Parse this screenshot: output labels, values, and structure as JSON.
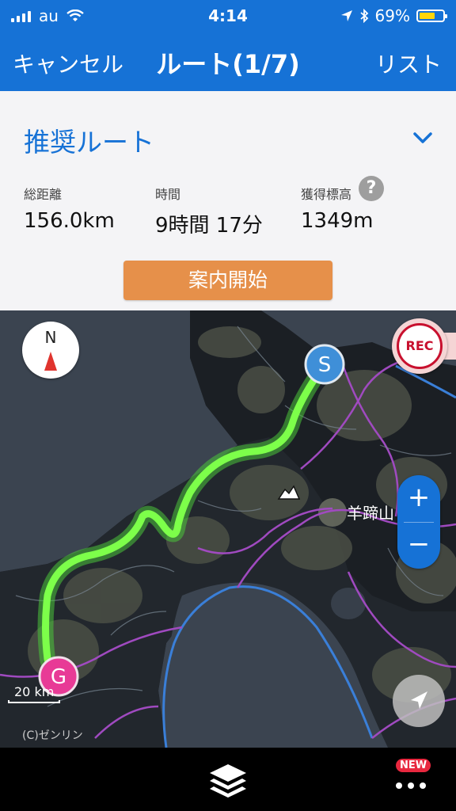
{
  "status_bar": {
    "carrier": "au",
    "time": "4:14",
    "battery_percent": "69%",
    "battery_level": 0.69
  },
  "nav": {
    "cancel_label": "キャンセル",
    "title": "ルート(1/7)",
    "list_label": "リスト"
  },
  "route": {
    "name": "推奨ルート",
    "stats": [
      {
        "label": "総距離",
        "value": "156.0km"
      },
      {
        "label": "時間",
        "value": "9時間 17分"
      },
      {
        "label": "獲得標高",
        "value": "1349m"
      }
    ],
    "help_label": "?",
    "start_button": "案内開始"
  },
  "map": {
    "compass_label": "N",
    "rec_label": "REC",
    "start_marker": "S",
    "goal_marker": "G",
    "peak_label": "羊蹄山",
    "zoom_in": "+",
    "zoom_out": "−",
    "scale_label": "20 km",
    "copyright": "(C)ゼンリン",
    "colors": {
      "route": "#7dff4a",
      "start": "#3f8fd8",
      "goal": "#e83a96",
      "road_purple": "#a04ac0",
      "road_blue": "#3a7fd8"
    }
  },
  "bottom_bar": {
    "badge": "NEW",
    "layers_icon": "layers-icon",
    "more_icon": "more-dots-icon"
  },
  "colors": {
    "accent": "#1672d6",
    "start_button": "#e6904a"
  }
}
